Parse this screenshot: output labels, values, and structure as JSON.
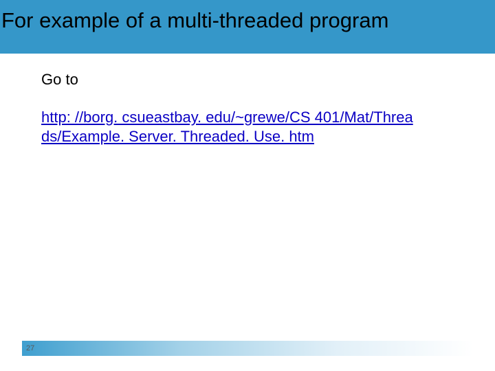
{
  "title": "For example of a multi-threaded program",
  "body": {
    "intro": "Go to",
    "link_line1": "http: //borg. csueastbay. edu/~grewe/CS 401/Mat/Threa",
    "link_line2": "ds/Example. Server. Threaded. Use. htm"
  },
  "footer": {
    "page_number": "27"
  },
  "colors": {
    "title_bar": "#3597c9",
    "link": "#0b00c4"
  }
}
